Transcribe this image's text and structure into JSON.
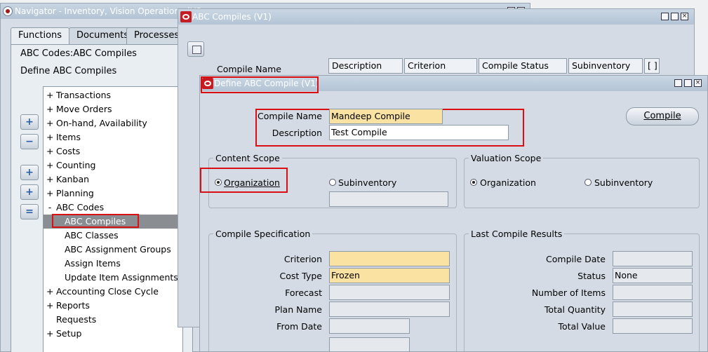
{
  "navigator": {
    "title": "Navigator - Inventory, Vision Operations (US",
    "tabs": [
      "Functions",
      "Documents",
      "Processes"
    ],
    "path_line": "ABC Codes:ABC Compiles",
    "define_line": "Define ABC Compiles",
    "tree": [
      {
        "sym": "+",
        "label": "Transactions"
      },
      {
        "sym": "+",
        "label": "Move Orders"
      },
      {
        "sym": "+",
        "label": "On-hand, Availability"
      },
      {
        "sym": "+",
        "label": "Items"
      },
      {
        "sym": "+",
        "label": "Costs"
      },
      {
        "sym": "+",
        "label": "Counting"
      },
      {
        "sym": "+",
        "label": "Kanban"
      },
      {
        "sym": "+",
        "label": "Planning"
      },
      {
        "sym": "-",
        "label": "ABC Codes"
      },
      {
        "sym": "",
        "label": "ABC Compiles"
      },
      {
        "sym": "",
        "label": "ABC Classes"
      },
      {
        "sym": "",
        "label": "ABC Assignment Groups"
      },
      {
        "sym": "",
        "label": "Assign Items"
      },
      {
        "sym": "",
        "label": "Update Item Assignments"
      },
      {
        "sym": "+",
        "label": "Accounting Close Cycle"
      },
      {
        "sym": "+",
        "label": "Reports"
      },
      {
        "sym": "",
        "label": "Requests"
      },
      {
        "sym": "+",
        "label": "Setup"
      }
    ]
  },
  "abc_compiles": {
    "title": "ABC Compiles (V1)",
    "compile_name_label": "Compile Name",
    "columns": [
      "Description",
      "Criterion",
      "Compile Status",
      "Subinventory",
      "[ ]"
    ]
  },
  "define": {
    "title": "Define ABC Compile (V1)",
    "compile_name_label": "Compile Name",
    "compile_name_value": "Mandeep Compile",
    "description_label": "Description",
    "description_value": "Test Compile",
    "compile_button": "Compile",
    "content_scope": {
      "label": "Content Scope",
      "org": "Organization",
      "sub": "Subinventory"
    },
    "valuation_scope": {
      "label": "Valuation Scope",
      "org": "Organization",
      "sub": "Subinventory"
    },
    "spec": {
      "label": "Compile Specification",
      "criterion": "Criterion",
      "cost_type": "Cost Type",
      "cost_type_value": "Frozen",
      "forecast": "Forecast",
      "plan_name": "Plan Name",
      "from_date": "From Date"
    },
    "results": {
      "label": "Last Compile Results",
      "compile_date": "Compile Date",
      "status": "Status",
      "status_value": "None",
      "num_items": "Number of Items",
      "total_qty": "Total Quantity",
      "total_value": "Total Value"
    }
  },
  "colors": {
    "required_field": "#fae3a2",
    "highlight_box": "#d90f14",
    "oracle_red": "#c51c23"
  }
}
